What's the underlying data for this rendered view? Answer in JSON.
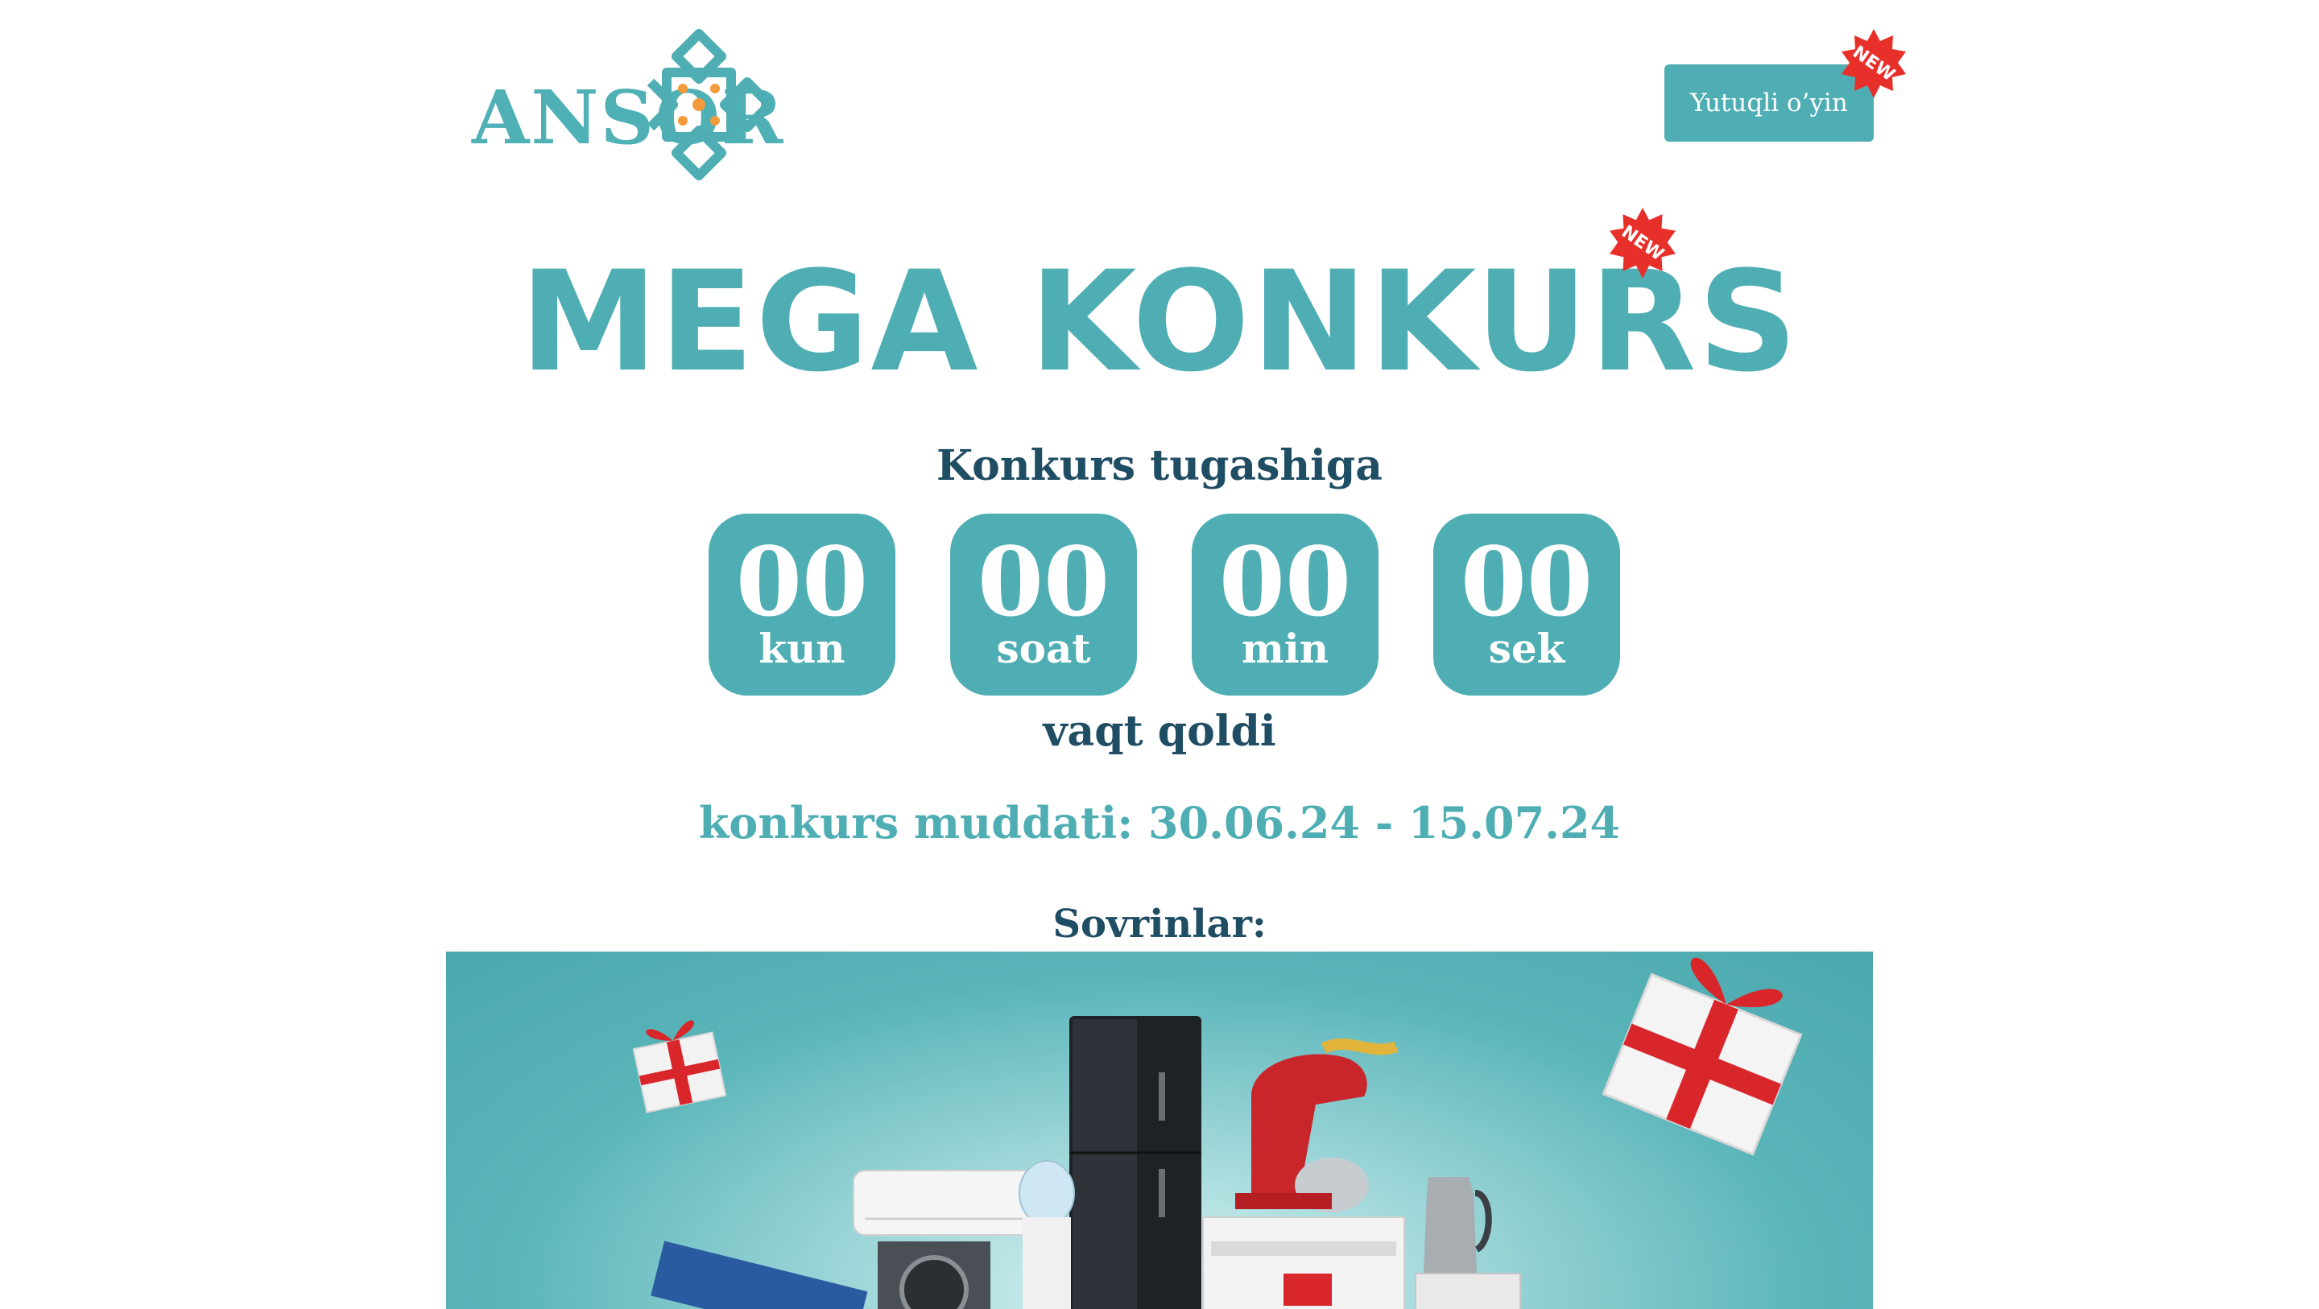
{
  "brand": {
    "logo_text": "ANSOR",
    "colors": {
      "teal": "#4faeb4",
      "navy": "#1f4d63",
      "badge_red": "#e8302a",
      "orange": "#f39a3a"
    }
  },
  "header": {
    "game_button_label": "Yutuqli o’yin",
    "badge_label": "NEW"
  },
  "hero": {
    "title": "MEGA KONKURS",
    "badge_label": "NEW"
  },
  "countdown": {
    "heading": "Konkurs tugashiga",
    "items": [
      {
        "value": "00",
        "unit": "kun"
      },
      {
        "value": "00",
        "unit": "soat"
      },
      {
        "value": "00",
        "unit": "min"
      },
      {
        "value": "00",
        "unit": "sek"
      }
    ],
    "footer": "vaqt qoldi"
  },
  "period": {
    "text": "konkurs muddati: 30.06.24 - 15.07.24"
  },
  "prizes": {
    "heading": "Sovrinlar:"
  },
  "banner": {
    "icons": [
      "gift-icon",
      "refrigerator-icon",
      "stand-mixer-icon",
      "washing-machine-icon",
      "air-conditioner-icon",
      "water-cooler-icon",
      "stove-icon",
      "kettle-icon",
      "tv-icon"
    ]
  }
}
